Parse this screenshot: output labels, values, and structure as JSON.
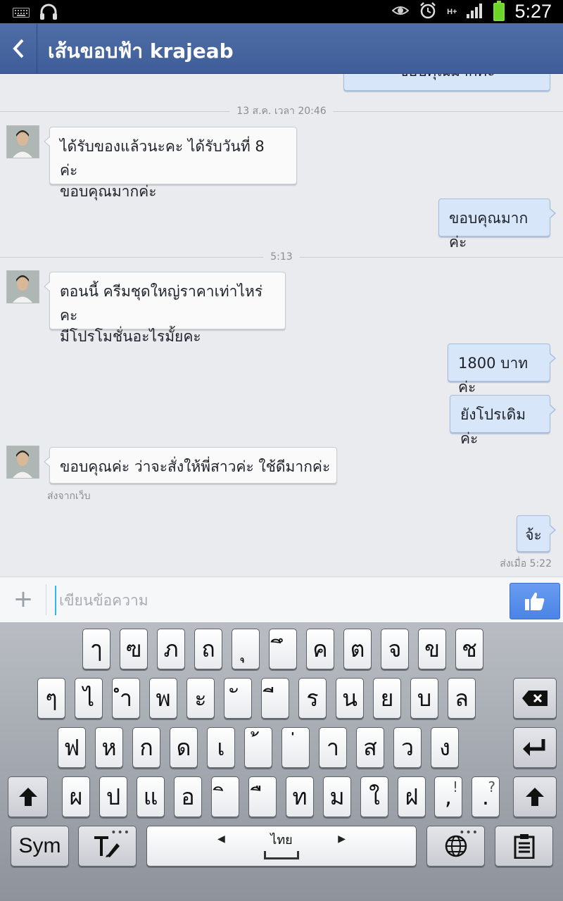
{
  "status_bar": {
    "time": "5:27",
    "network": "H+"
  },
  "header": {
    "title": "เส้นขอบฟ้า krajeab"
  },
  "chat": {
    "partial_top_message": "ขอบคุณมากค่ะ",
    "divider_1": "13 ส.ค. เวลา 20:46",
    "msg_in_1_line1": "ได้รับของแล้วนะคะ ได้รับวันที่ 8 ค่ะ",
    "msg_in_1_line2": "ขอบคุณมากค่ะ",
    "msg_out_1": "ขอบคุณมากค่ะ",
    "divider_2": "5:13",
    "msg_in_2_line1": "ตอนนี้ ครีมชุดใหญ่ราคาเท่าไหร่คะ",
    "msg_in_2_line2": "มีโปรโมชั่นอะไรมั้ยคะ",
    "msg_out_2": "1800 บาทค่ะ",
    "msg_out_3": "ยังโปรเดิมค่ะ",
    "msg_in_3": "ขอบคุณค่ะ ว่าจะสั่งให้พี่สาวค่ะ ใช้ดีมากค่ะ",
    "msg_in_3_meta": "ส่งจากเว็บ",
    "msg_out_4": "จ้ะ",
    "msg_out_4_meta": "ส่งเมื่อ 5:22"
  },
  "composer": {
    "placeholder": "เขียนข้อความ",
    "add_label": "+"
  },
  "keyboard": {
    "row1": [
      "ๅ",
      "ฃ",
      "ภ",
      "ถ",
      "ุ",
      "ึ",
      "ค",
      "ต",
      "จ",
      "ข",
      "ช"
    ],
    "row2": [
      "ๆ",
      "ไ",
      "ำ",
      "พ",
      "ะ",
      "ั",
      "ี",
      "ร",
      "น",
      "ย",
      "บ",
      "ล"
    ],
    "row3": [
      "ฟ",
      "ห",
      "ก",
      "ด",
      "เ",
      "้",
      "่",
      "า",
      "ส",
      "ว",
      "ง"
    ],
    "row4": [
      "ผ",
      "ป",
      "แ",
      "อ",
      "ิ",
      "ื",
      "ท",
      "ม",
      "ใ",
      "ฝ"
    ],
    "comma": ",",
    "comma_sub": "!",
    "period": ".",
    "period_sub": "?",
    "sym_label": "Sym",
    "language_label": "ไทย"
  },
  "colors": {
    "header_bg": "#4267a8",
    "incoming_bubble": "#fafafa",
    "outgoing_bubble": "#d8e6fa",
    "like_button": "#5a8eea"
  }
}
